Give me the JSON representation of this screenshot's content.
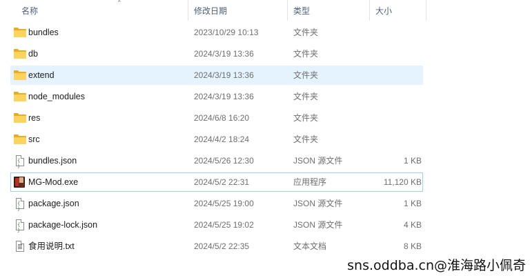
{
  "columns": {
    "name": "名称",
    "date": "修改日期",
    "type": "类型",
    "size": "大小"
  },
  "files": [
    {
      "name": "bundles",
      "date": "2023/10/29 10:13",
      "type": "文件夹",
      "size": "",
      "icon": "folder-icon"
    },
    {
      "name": "db",
      "date": "2024/3/19 13:36",
      "type": "文件夹",
      "size": "",
      "icon": "folder-icon"
    },
    {
      "name": "extend",
      "date": "2024/3/19 13:36",
      "type": "文件夹",
      "size": "",
      "icon": "folder-icon"
    },
    {
      "name": "node_modules",
      "date": "2024/3/19 13:36",
      "type": "文件夹",
      "size": "",
      "icon": "folder-icon"
    },
    {
      "name": "res",
      "date": "2024/6/8 16:20",
      "type": "文件夹",
      "size": "",
      "icon": "folder-icon"
    },
    {
      "name": "src",
      "date": "2024/4/2 18:24",
      "type": "文件夹",
      "size": "",
      "icon": "folder-icon"
    },
    {
      "name": "bundles.json",
      "date": "2024/5/26 12:30",
      "type": "JSON 源文件",
      "size": "1 KB",
      "icon": "json-file-icon"
    },
    {
      "name": "MG-Mod.exe",
      "date": "2024/5/2 22:31",
      "type": "应用程序",
      "size": "11,120 KB",
      "icon": "exe-icon"
    },
    {
      "name": "package.json",
      "date": "2024/5/25 19:00",
      "type": "JSON 源文件",
      "size": "1 KB",
      "icon": "json-file-icon"
    },
    {
      "name": "package-lock.json",
      "date": "2024/5/25 19:02",
      "type": "JSON 源文件",
      "size": "4 KB",
      "icon": "json-file-icon"
    },
    {
      "name": "食用说明.txt",
      "date": "2024/5/2 22:35",
      "type": "文本文档",
      "size": "8 KB",
      "icon": "text-file-icon"
    }
  ],
  "watermark": "sns.oddba.cn@淮海路小佩奇",
  "colors": {
    "selection": "#e5f3ff",
    "focus_border": "#99d1ff",
    "folder": "#fcd35d"
  }
}
